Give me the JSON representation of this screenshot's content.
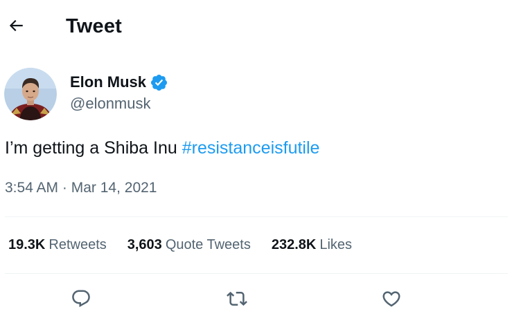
{
  "header": {
    "title": "Tweet",
    "back_icon": "arrow-left-icon"
  },
  "author": {
    "name": "Elon Musk",
    "handle": "@elonmusk",
    "verified_icon": "verified-badge-icon",
    "verified_color": "#1d9bf0"
  },
  "tweet": {
    "text": "I’m getting a Shiba Inu ",
    "hashtag": "#resistanceisfutile",
    "time": "3:54 AM",
    "separator": " · ",
    "date": "Mar 14, 2021"
  },
  "stats": {
    "retweets": {
      "count": "19.3K",
      "label": "Retweets"
    },
    "quotes": {
      "count": "3,603",
      "label": "Quote Tweets"
    },
    "likes": {
      "count": "232.8K",
      "label": "Likes"
    }
  },
  "actions": {
    "reply_icon": "reply-icon",
    "retweet_icon": "retweet-icon",
    "like_icon": "heart-icon"
  },
  "colors": {
    "accent": "#1d9bf0",
    "text_primary": "#0f1419",
    "text_secondary": "#536471",
    "divider": "#eff3f4"
  }
}
